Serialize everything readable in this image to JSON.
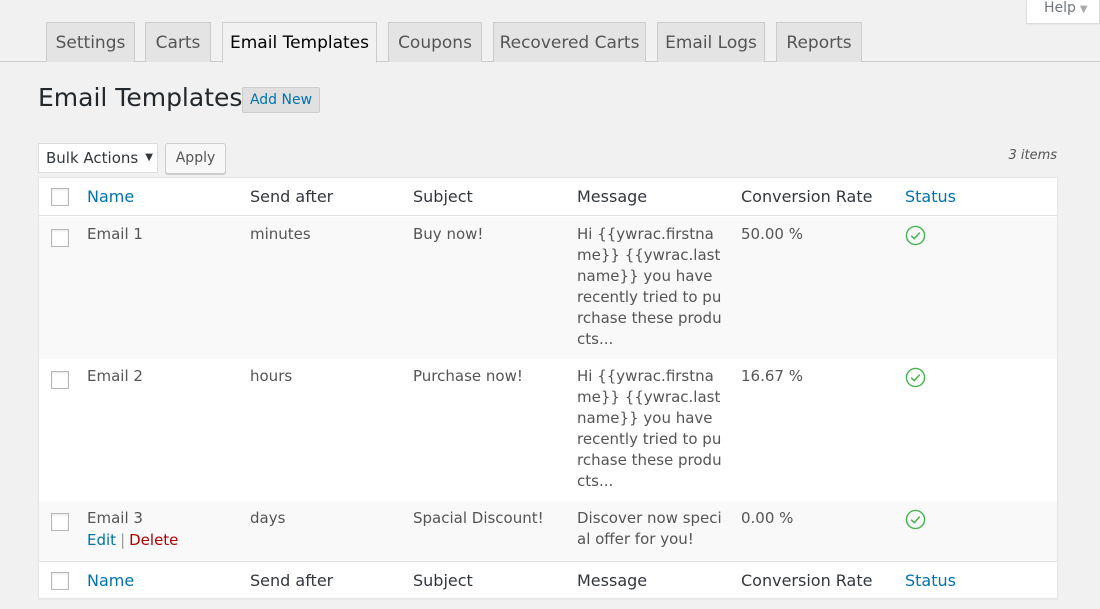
{
  "help": {
    "label": "Help"
  },
  "tabs": [
    {
      "label": "Settings"
    },
    {
      "label": "Carts"
    },
    {
      "label": "Email Templates"
    },
    {
      "label": "Coupons"
    },
    {
      "label": "Recovered Carts"
    },
    {
      "label": "Email Logs"
    },
    {
      "label": "Reports"
    }
  ],
  "page": {
    "title": "Email Templates",
    "add_new": "Add New"
  },
  "toolbar": {
    "bulk_actions": "Bulk Actions",
    "apply": "Apply",
    "item_count": "3 items"
  },
  "table": {
    "columns": {
      "name": "Name",
      "send_after": "Send after",
      "subject": "Subject",
      "message": "Message",
      "conversion_rate": "Conversion Rate",
      "status": "Status"
    },
    "rows": [
      {
        "name": "Email 1",
        "send_after": "minutes",
        "subject": "Buy now!",
        "message": "Hi {{ywrac.firstname}} {{ywrac.lastname}} you have recently tried to purchase these products...",
        "conversion_rate": "50.00 %",
        "status": "active"
      },
      {
        "name": "Email 2",
        "send_after": "hours",
        "subject": "Purchase now!",
        "message": "Hi {{ywrac.firstname}} {{ywrac.lastname}} you have recently tried to purchase these products...",
        "conversion_rate": "16.67 %",
        "status": "active"
      },
      {
        "name": "Email 3",
        "send_after": "days",
        "subject": "Spacial Discount!",
        "message": "Discover now special offer for you!",
        "conversion_rate": "0.00 %",
        "status": "active",
        "actions": {
          "edit": "Edit",
          "separator": "|",
          "delete": "Delete"
        }
      }
    ]
  },
  "colors": {
    "link": "#0073aa",
    "delete": "#aa0000",
    "status_ok": "#46b450",
    "background": "#f1f1f1"
  }
}
